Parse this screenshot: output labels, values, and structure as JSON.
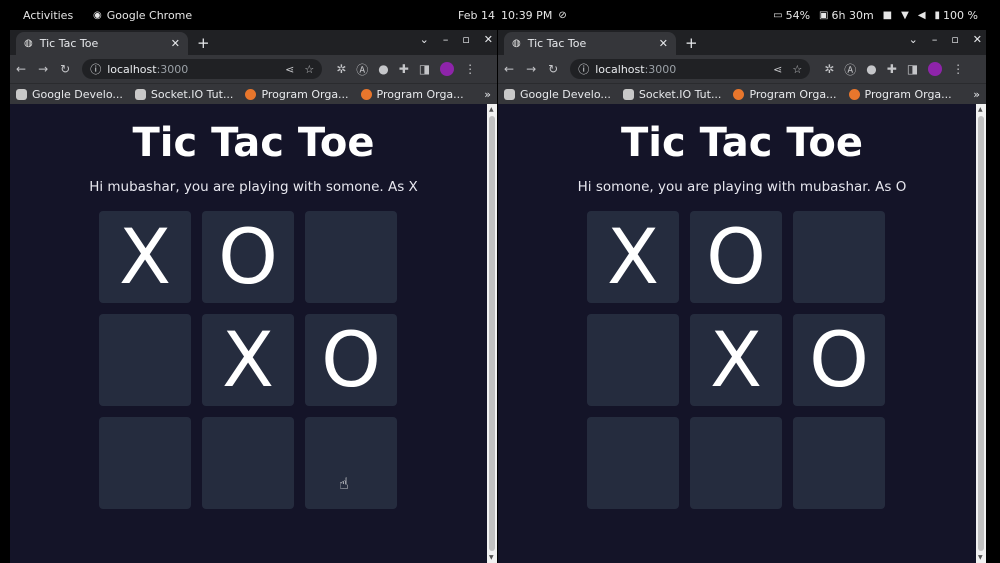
{
  "topbar": {
    "activities": "Activities",
    "app_name": "Google Chrome",
    "date": "Feb 14",
    "time": "10:39 PM",
    "tray": [
      "54%",
      "6h 30m",
      "100 %"
    ]
  },
  "browser": {
    "tab_title": "Tic Tac Toe",
    "url_host": "localhost",
    "url_port": ":3000",
    "bookmarks": [
      "Google Develo...",
      "Socket.IO Tut...",
      "Program Orga...",
      "Program Orga..."
    ],
    "bookmarks_more": "»"
  },
  "game": {
    "title": "Tic Tac Toe",
    "left_greeting": "Hi mubashar, you are playing with somone. As X",
    "right_greeting": "Hi somone, you are playing with mubashar. As O",
    "board": [
      "X",
      "O",
      "",
      "",
      "X",
      "O",
      "",
      "",
      ""
    ]
  }
}
